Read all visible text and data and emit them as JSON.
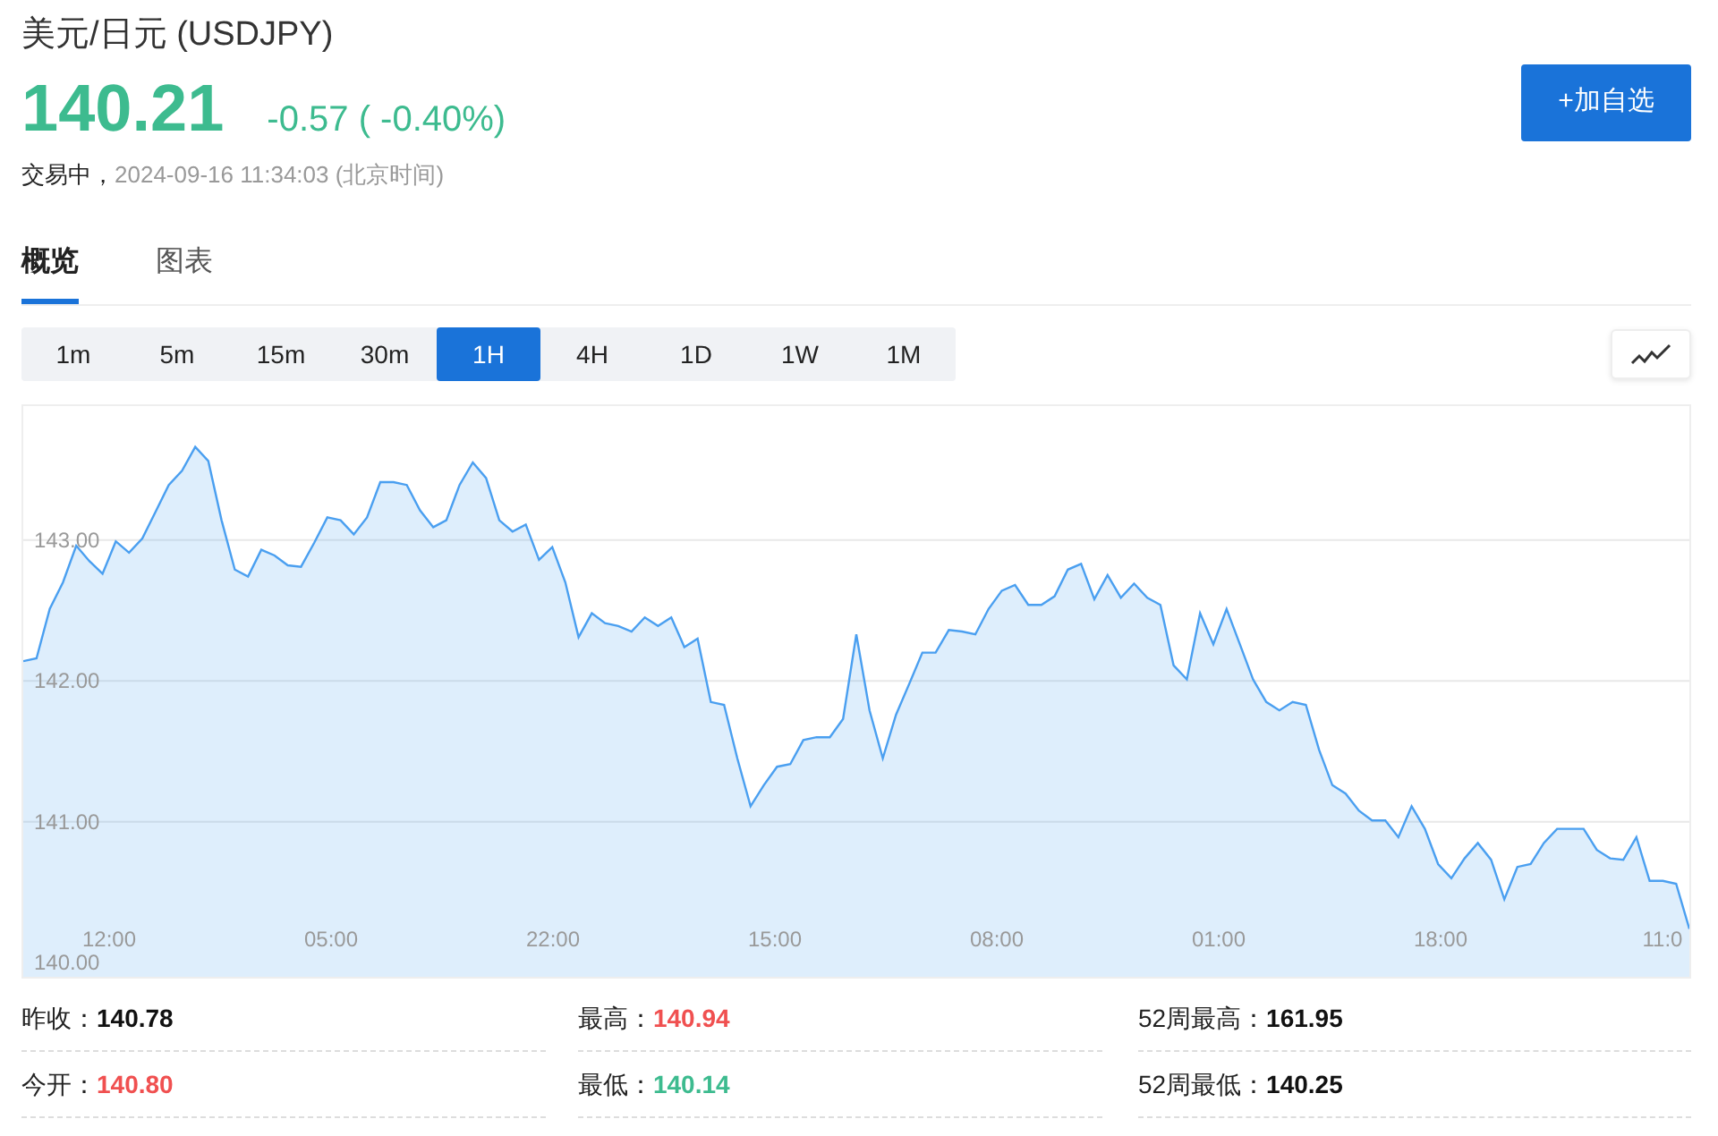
{
  "title": "美元/日元",
  "symbol": "(USDJPY)",
  "quote": {
    "price": "140.21",
    "change": "-0.57",
    "change_percent": "( -0.40%)",
    "color": "#3dbb8f"
  },
  "status": "交易中，",
  "timestamp": "2024-09-16 11:34:03",
  "timezone": "(北京时间)",
  "watch_button": "+加自选",
  "tabs": [
    {
      "label": "概览",
      "selected": true
    },
    {
      "label": "图表",
      "selected": false
    }
  ],
  "periods": [
    {
      "label": "1m",
      "selected": false
    },
    {
      "label": "5m",
      "selected": false
    },
    {
      "label": "15m",
      "selected": false
    },
    {
      "label": "30m",
      "selected": false
    },
    {
      "label": "1H",
      "selected": true
    },
    {
      "label": "4H",
      "selected": false
    },
    {
      "label": "1D",
      "selected": false
    },
    {
      "label": "1W",
      "selected": false
    },
    {
      "label": "1M",
      "selected": false
    }
  ],
  "chart": {
    "time_labels": [
      "12:00",
      "05:00",
      "22:00",
      "15:00",
      "08:00",
      "01:00",
      "18:00",
      "11:0"
    ],
    "chart_data": {
      "type": "area",
      "grid": true,
      "ylim": [
        139.9,
        143.95
      ],
      "yticks": [
        {
          "value": 140,
          "label": "140.00"
        },
        {
          "value": 141,
          "label": "141.00"
        },
        {
          "value": 142,
          "label": "142.00"
        },
        {
          "value": 143,
          "label": "143.00"
        }
      ],
      "series": [
        {
          "color": "#4a9ff0",
          "values": [
            142.14,
            142.16,
            142.51,
            142.7,
            142.96,
            142.85,
            142.76,
            142.99,
            142.91,
            143.01,
            143.2,
            143.39,
            143.49,
            143.66,
            143.56,
            143.14,
            142.79,
            142.74,
            142.93,
            142.89,
            142.82,
            142.81,
            142.98,
            143.16,
            143.14,
            143.04,
            143.16,
            143.41,
            143.41,
            143.39,
            143.21,
            143.09,
            143.14,
            143.39,
            143.55,
            143.44,
            143.14,
            143.06,
            143.11,
            142.86,
            142.95,
            142.7,
            142.31,
            142.48,
            142.41,
            142.39,
            142.35,
            142.45,
            142.39,
            142.45,
            142.24,
            142.3,
            141.85,
            141.83,
            141.45,
            141.11,
            141.26,
            141.39,
            141.41,
            141.58,
            141.6,
            141.6,
            141.73,
            142.33,
            141.79,
            141.45,
            141.76,
            141.98,
            142.2,
            142.2,
            142.36,
            142.35,
            142.33,
            142.51,
            142.64,
            142.68,
            142.54,
            142.54,
            142.6,
            142.79,
            142.83,
            142.58,
            142.75,
            142.59,
            142.69,
            142.59,
            142.54,
            142.11,
            142.01,
            142.48,
            142.26,
            142.51,
            142.26,
            142.01,
            141.85,
            141.79,
            141.85,
            141.83,
            141.51,
            141.26,
            141.2,
            141.08,
            141.01,
            141.01,
            140.89,
            141.11,
            140.95,
            140.7,
            140.6,
            140.74,
            140.85,
            140.73,
            140.45,
            140.68,
            140.7,
            140.85,
            140.95,
            140.95,
            140.95,
            140.8,
            140.74,
            140.73,
            140.89,
            140.58,
            140.58,
            140.56,
            140.24
          ]
        }
      ]
    }
  },
  "stats": [
    {
      "label": "昨收：",
      "value": "140.78",
      "color": "#111111"
    },
    {
      "label": "最高：",
      "value": "140.94",
      "color": "#f05050"
    },
    {
      "label": "52周最高：",
      "value": "161.95",
      "color": "#111111"
    },
    {
      "label": "今开：",
      "value": "140.80",
      "color": "#f05050"
    },
    {
      "label": "最低：",
      "value": "140.14",
      "color": "#3dbb8f"
    },
    {
      "label": "52周最低：",
      "value": "140.25",
      "color": "#111111"
    }
  ]
}
